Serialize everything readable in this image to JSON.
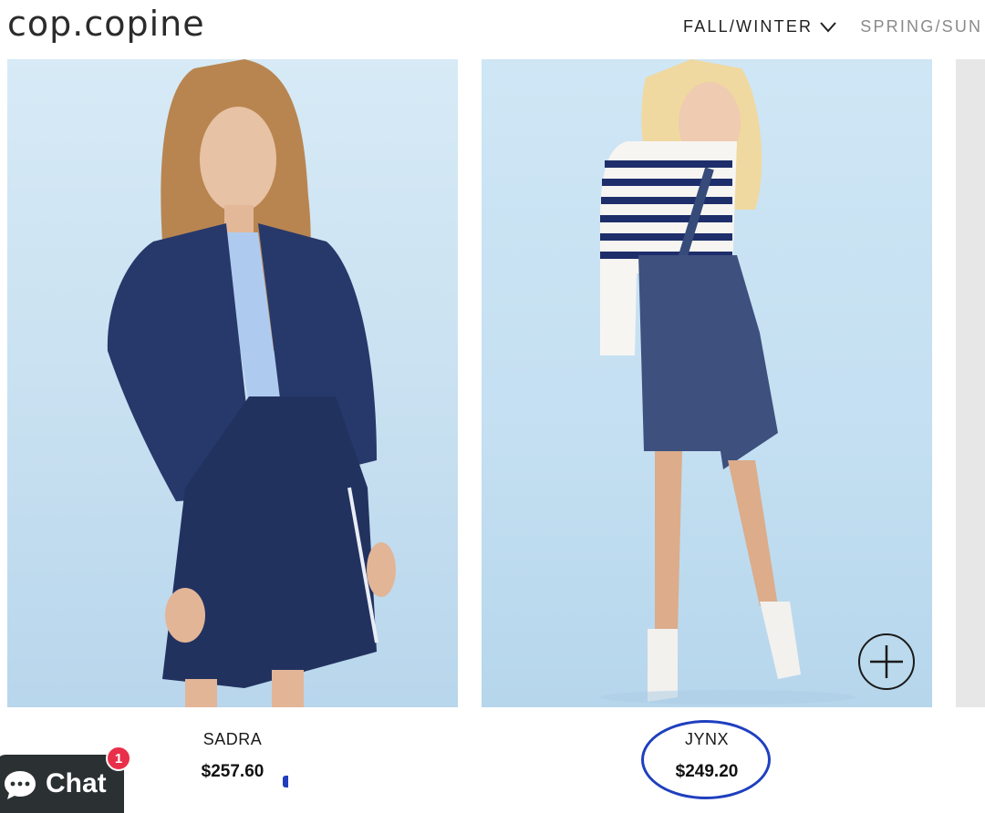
{
  "header": {
    "logo": "cop.copine",
    "nav": [
      {
        "label": "FALL/WINTER"
      },
      {
        "label": "SPRING/SUN"
      }
    ]
  },
  "products": [
    {
      "name": "SADRA",
      "price": "$257.60"
    },
    {
      "name": "JYNX",
      "price": "$249.20"
    }
  ],
  "chat": {
    "label": "Chat",
    "badge": "1"
  },
  "colors": {
    "annotation": "#1f3fbf",
    "badge": "#e8304a",
    "chat_bg": "#2b3033"
  }
}
